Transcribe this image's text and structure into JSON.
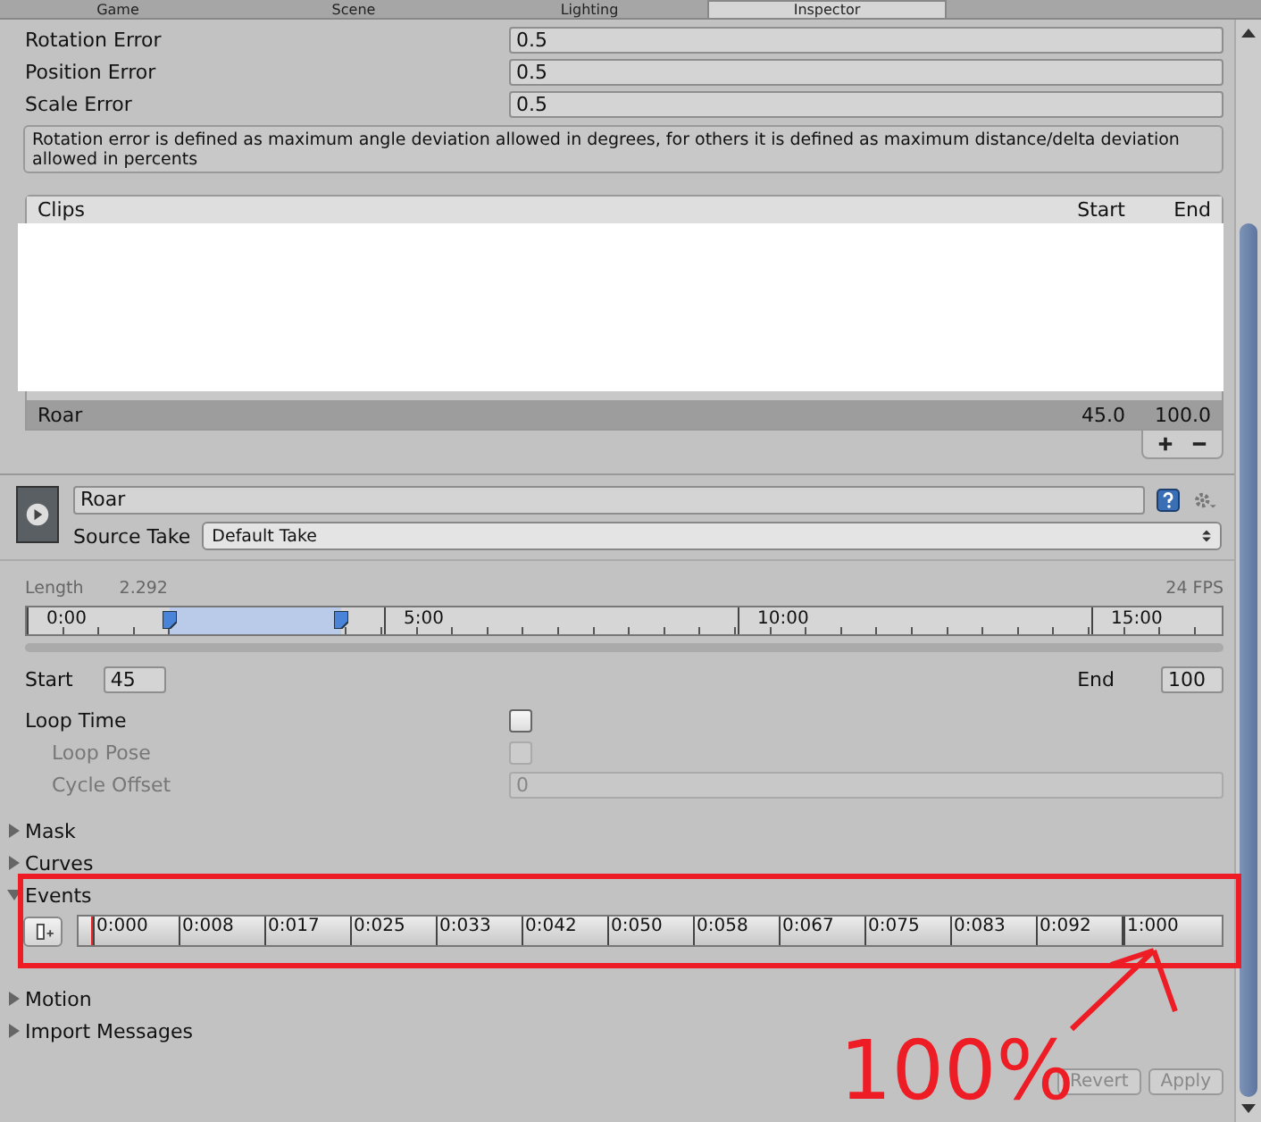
{
  "tabs": [
    {
      "label": "Game",
      "selected": false
    },
    {
      "label": "Scene",
      "selected": false
    },
    {
      "label": "Lighting",
      "selected": false
    },
    {
      "label": "Inspector",
      "selected": true
    }
  ],
  "error_settings": [
    {
      "label": "Rotation Error",
      "value": "0.5"
    },
    {
      "label": "Position Error",
      "value": "0.5"
    },
    {
      "label": "Scale Error",
      "value": "0.5"
    }
  ],
  "help_text": "Rotation error is defined as maximum angle deviation allowed in degrees, for others it is defined as maximum distance/delta deviation allowed in percents",
  "clips": {
    "columns": [
      "Clips",
      "Start",
      "End"
    ],
    "rows": [
      {
        "name": "Roar",
        "start": "45.0",
        "end": "100.0",
        "selected": true
      }
    ]
  },
  "clip": {
    "name": "Roar",
    "source_take_label": "Source Take",
    "source_take": "Default Take",
    "length_label": "Length",
    "length": "2.292",
    "fps": "24 FPS",
    "timeline_labels": [
      "0:00",
      "5:00",
      "10:00",
      "15:00"
    ],
    "start_label": "Start",
    "start": "45",
    "end_label": "End",
    "end": "100"
  },
  "loop": [
    {
      "label": "Loop Time",
      "kind": "checkbox",
      "checked": false,
      "disabled": false,
      "children": [
        {
          "label": "Loop Pose",
          "kind": "checkbox",
          "checked": false,
          "disabled": true
        },
        {
          "label": "Cycle Offset",
          "kind": "field",
          "value": "0",
          "disabled": true
        }
      ]
    }
  ],
  "sections_top": [
    {
      "label": "Mask",
      "expanded": false
    },
    {
      "label": "Curves",
      "expanded": false
    },
    {
      "label": "Events",
      "expanded": true
    }
  ],
  "events_ruler": [
    "0:000",
    "0:008",
    "0:017",
    "0:025",
    "0:033",
    "0:042",
    "0:050",
    "0:058",
    "0:067",
    "0:075",
    "0:083",
    "0:092",
    "1:000"
  ],
  "sections_bottom": [
    {
      "label": "Motion",
      "expanded": false
    },
    {
      "label": "Import Messages",
      "expanded": false
    }
  ],
  "buttons": [
    {
      "label": "Revert",
      "disabled": true
    },
    {
      "label": "Apply",
      "disabled": true
    }
  ],
  "annotation": {
    "text": "100%"
  }
}
